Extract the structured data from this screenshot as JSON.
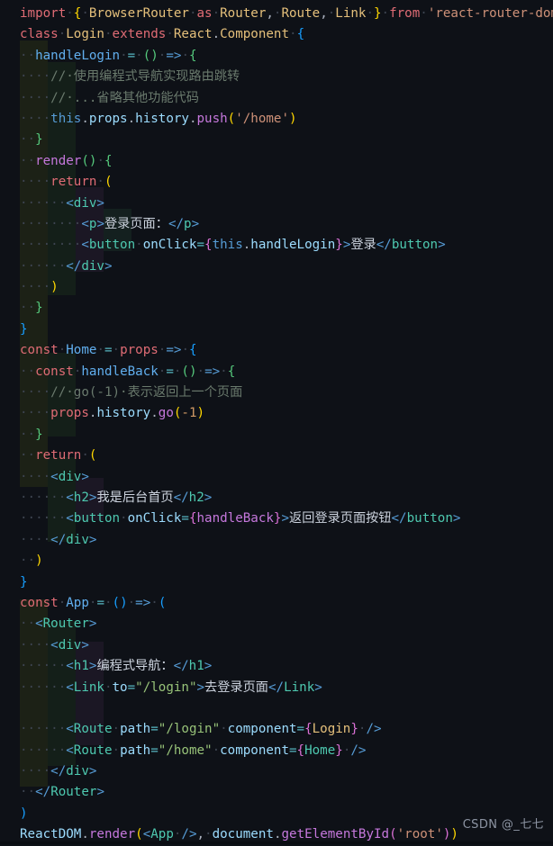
{
  "editor": {
    "background": "#0e1117",
    "font_size_px": 14.2,
    "line_height_px": 23.4,
    "language": "jsx",
    "watermark": "CSDN @_七七"
  },
  "code": {
    "raw_lines": [
      "import { BrowserRouter as Router, Route, Link } from 'react-router-dom'",
      "class Login extends React.Component {",
      "  handleLogin = () => {",
      "    // 使用编程式导航实现路由跳转",
      "    // ...省略其他功能代码",
      "    this.props.history.push('/home')",
      "  }",
      "  render() {",
      "    return (",
      "      <div>",
      "        <p>登录页面：</p>",
      "        <button onClick={this.handleLogin}>登录</button>",
      "      </div>",
      "    )",
      "  }",
      "}",
      "const Home = props => {",
      "  const handleBack = () => {",
      "    // go(-1) 表示返回上一个页面",
      "    props.history.go(-1)",
      "  }",
      "  return (",
      "    <div>",
      "      <h2>我是后台首页</h2>",
      "      <button onClick={handleBack}>返回登录页面按钮</button>",
      "    </div>",
      "  )",
      "}",
      "const App = () => (",
      "  <Router>",
      "    <div>",
      "      <h1>编程式导航：</h1>",
      "      <Link to=\"/login\">去登录页面</Link>",
      "",
      "      <Route path=\"/login\" component={Login} />",
      "      <Route path=\"/home\" component={Home} />",
      "    </div>",
      "  </Router>",
      ")",
      "ReactDOM.render(<App />, document.getElementById('root'))"
    ],
    "comments": [
      "// 使用编程式导航实现路由跳转",
      "// ...省略其他功能代码",
      "// go(-1) 表示返回上一个页面"
    ],
    "strings": [
      "'react-router-dom'",
      "'/home'",
      "\"/login\"",
      "\"/home\"",
      "'root'"
    ],
    "jsx_text": [
      "登录页面：",
      "登录",
      "我是后台首页",
      "返回登录页面按钮",
      "编程式导航：",
      "去登录页面"
    ],
    "identifiers": [
      "BrowserRouter",
      "Router",
      "Route",
      "Link",
      "Login",
      "React.Component",
      "handleLogin",
      "render",
      "Home",
      "props",
      "handleBack",
      "App",
      "ReactDOM"
    ]
  },
  "theme_colors": {
    "background": "#0e1117",
    "keyword": "#e06c75",
    "type": "#e5c07b",
    "function": "#61afef",
    "string": "#ce9178",
    "jsx_string": "#98c379",
    "comment": "#6a7a6d",
    "tag": "#4ec9b0",
    "attribute": "#9cdcfe",
    "bracket_gold": "#ffd700",
    "bracket_orchid": "#da70d6",
    "bracket_blue": "#179fff"
  }
}
